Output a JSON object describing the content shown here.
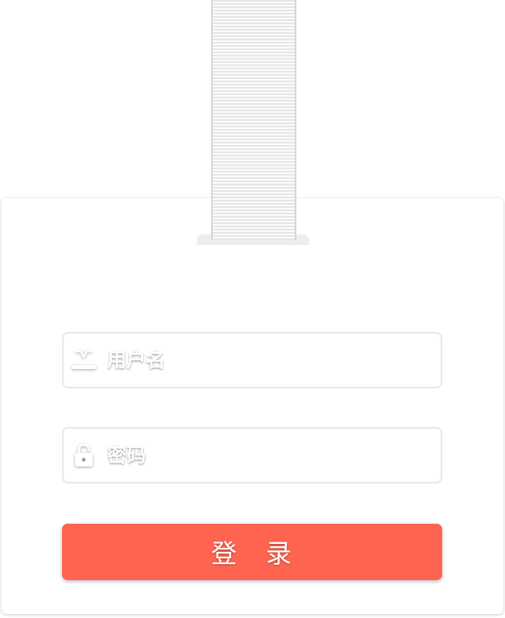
{
  "login_form": {
    "username": {
      "icon": "user-icon",
      "placeholder": "用户名",
      "value": ""
    },
    "password": {
      "icon": "lock-icon",
      "placeholder": "密码",
      "value": ""
    },
    "submit_label": "登　录"
  },
  "colors": {
    "accent": "#ff6450",
    "field_border": "#e8e8e8",
    "strap_stripe": "#e6e6e6"
  }
}
